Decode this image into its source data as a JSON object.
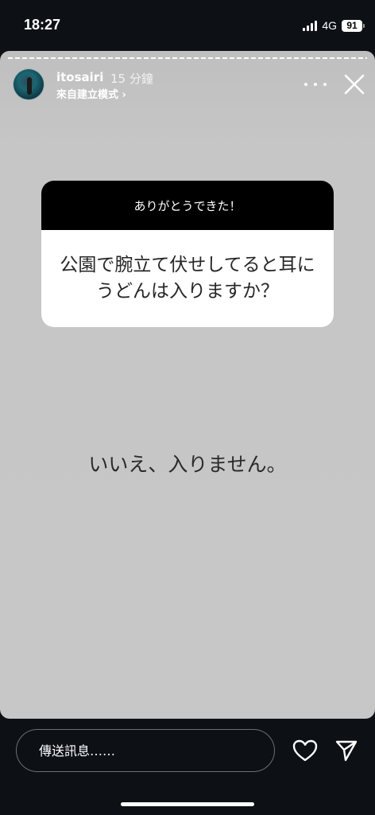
{
  "status_bar": {
    "time": "18:27",
    "network": "4G",
    "battery": "91"
  },
  "story": {
    "username": "itosairi",
    "time_ago": "15 分鐘",
    "created_with": "來自建立模式 ›",
    "icons": [
      "more-icon",
      "close-icon"
    ]
  },
  "question_sticker": {
    "header": "ありがとうできた！",
    "question": "公園で腕立て伏せしてると耳にうどんは入りますか？"
  },
  "answer": "いいえ、入りません。",
  "reply_bar": {
    "placeholder": "傳送訊息……",
    "icons": [
      "heart-icon",
      "send-icon"
    ]
  }
}
